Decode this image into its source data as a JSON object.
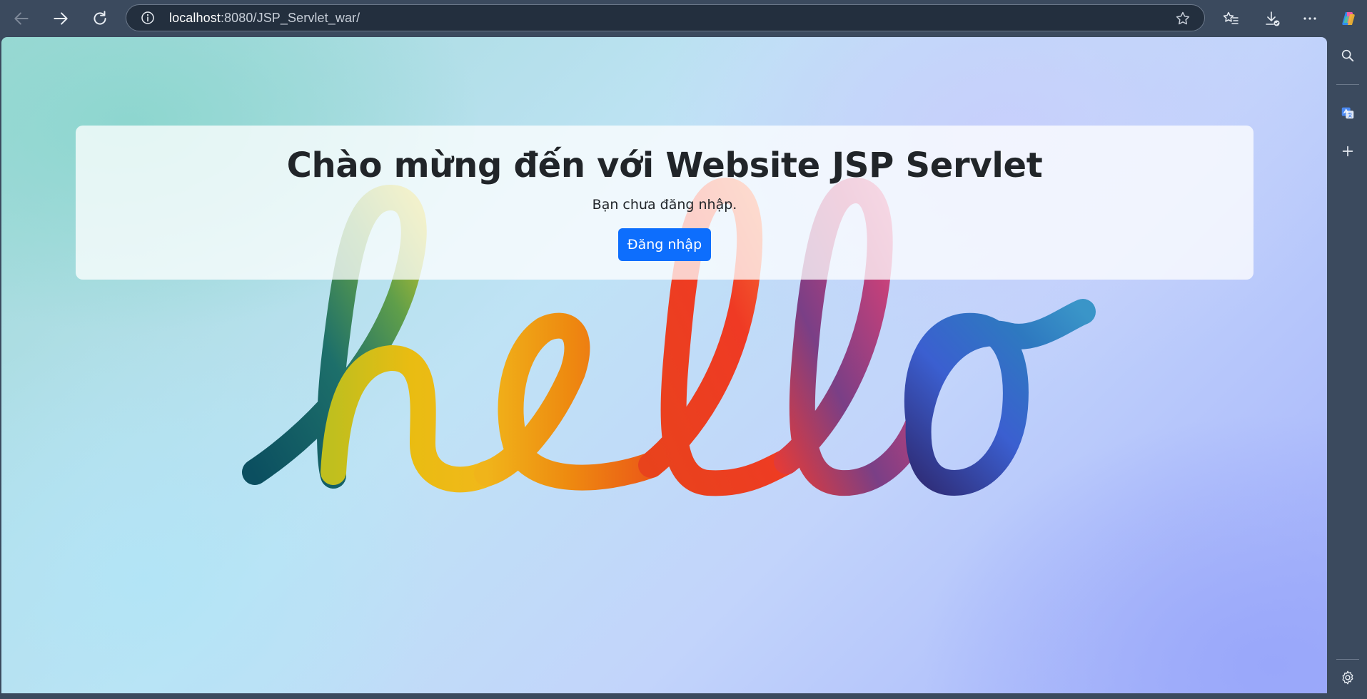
{
  "browser": {
    "url_host": "localhost",
    "url_rest": ":8080/JSP_Servlet_war/"
  },
  "page": {
    "heading": "Chào mừng đến với Website JSP Servlet",
    "message": "Bạn chưa đăng nhập.",
    "login_button": "Đăng nhập",
    "accent_color": "#0d6efd"
  },
  "background": {
    "lettering": "hello"
  },
  "icons": {
    "toolbar": [
      "back-arrow-icon",
      "forward-arrow-icon",
      "refresh-icon",
      "site-info-icon",
      "favorite-star-icon",
      "favorites-icon",
      "downloads-icon",
      "more-options-icon",
      "copilot-icon"
    ],
    "sidebar": [
      "search-icon",
      "translate-icon",
      "add-icon",
      "settings-gear-icon"
    ]
  }
}
